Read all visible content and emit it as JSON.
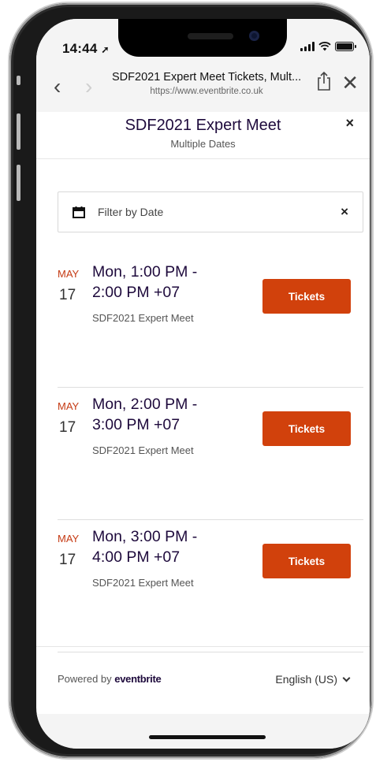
{
  "status": {
    "time": "14:44",
    "location_icon": "location-arrow-icon"
  },
  "browser": {
    "title": "SDF2021 Expert Meet Tickets, Mult...",
    "url": "https://www.eventbrite.co.uk",
    "back_icon": "chevron-left-icon",
    "forward_icon": "chevron-right-icon",
    "share_icon": "share-icon",
    "close_icon": "close-icon"
  },
  "modal": {
    "title": "SDF2021 Expert Meet",
    "subtitle": "Multiple Dates",
    "close_label": "×"
  },
  "filter": {
    "label": "Filter by Date",
    "clear_label": "×"
  },
  "events": [
    {
      "month": "MAY",
      "day": "17",
      "time": "Mon, 1:00 PM - 2:00 PM +07",
      "name": "SDF2021 Expert Meet",
      "button": "Tickets"
    },
    {
      "month": "MAY",
      "day": "17",
      "time": "Mon, 2:00 PM - 3:00 PM +07",
      "name": "SDF2021 Expert Meet",
      "button": "Tickets"
    },
    {
      "month": "MAY",
      "day": "17",
      "time": "Mon, 3:00 PM - 4:00 PM +07",
      "name": "SDF2021 Expert Meet",
      "button": "Tickets"
    }
  ],
  "footer": {
    "powered_prefix": "Powered by",
    "brand": "eventbrite",
    "language": "English (US)"
  },
  "colors": {
    "accent": "#d1410c",
    "month": "#c53a13",
    "title": "#1e0a3c"
  }
}
